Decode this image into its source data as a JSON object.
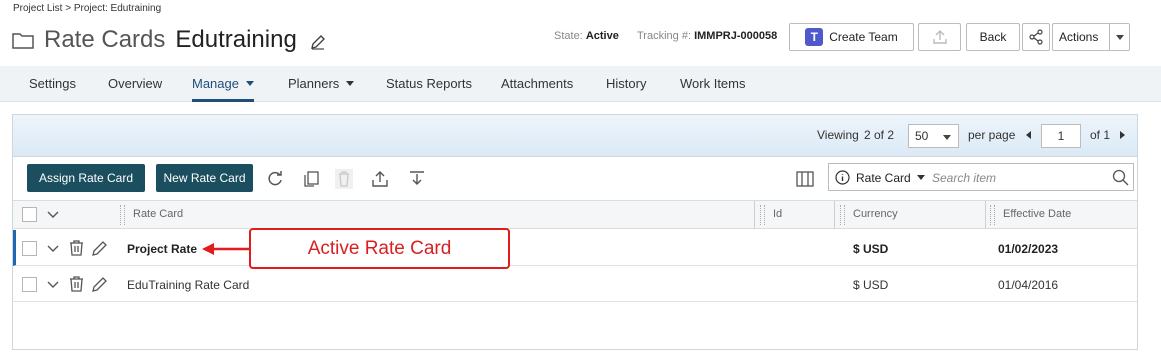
{
  "breadcrumb": "Project List > Project: Edutraining",
  "header": {
    "title_prefix": "Rate Cards",
    "title_name": "Edutraining",
    "state_label": "State:",
    "state_value": "Active",
    "tracking_label": "Tracking #:",
    "tracking_value": "IMMPRJ-000058",
    "create_team_label": "Create Team",
    "back_label": "Back",
    "actions_label": "Actions"
  },
  "tabs": [
    {
      "label": "Settings"
    },
    {
      "label": "Overview"
    },
    {
      "label": "Manage",
      "active": true
    },
    {
      "label": "Planners"
    },
    {
      "label": "Status Reports"
    },
    {
      "label": "Attachments"
    },
    {
      "label": "History"
    },
    {
      "label": "Work Items"
    }
  ],
  "pager": {
    "viewing_label": "Viewing",
    "viewing_value": "2 of 2",
    "per_page_value": "50",
    "per_page_label": "per page",
    "page_value": "1",
    "of_label": "of 1"
  },
  "toolbar": {
    "assign_label": "Assign Rate Card",
    "new_label": "New Rate Card",
    "search_field_label": "Rate Card",
    "search_placeholder": "Search item"
  },
  "table": {
    "columns": [
      "Rate Card",
      "Id",
      "Currency",
      "Effective Date"
    ],
    "rows": [
      {
        "rate_card": "Project Rate",
        "id": "",
        "currency": "$ USD",
        "effective_date": "01/02/2023",
        "active": true
      },
      {
        "rate_card": "EduTraining Rate Card",
        "id": "",
        "currency": "$ USD",
        "effective_date": "01/04/2016",
        "active": false
      }
    ]
  },
  "callout": {
    "label": "Active Rate Card"
  },
  "colors": {
    "primary": "#1b4f60",
    "tab_active": "#1f4e79",
    "callout": "#e21b1b",
    "row_indicator": "#1e66b3"
  }
}
